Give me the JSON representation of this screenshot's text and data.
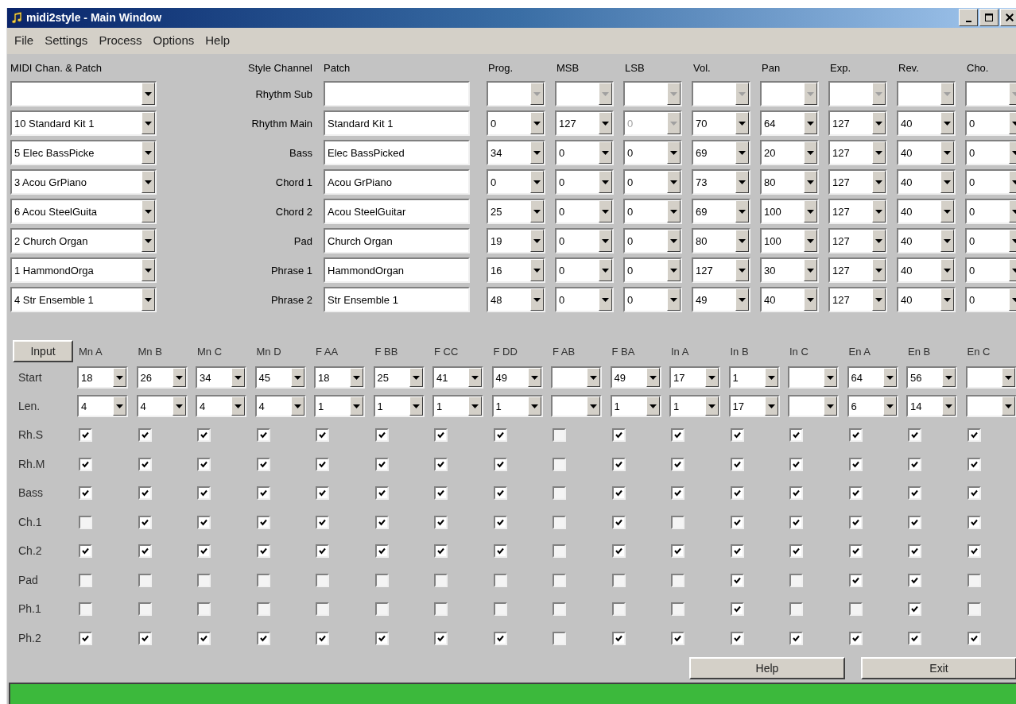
{
  "window": {
    "title": "midi2style - Main Window"
  },
  "menu": [
    "File",
    "Settings",
    "Process",
    "Options",
    "Help"
  ],
  "channel_table": {
    "columns": [
      "MIDI Chan. & Patch",
      "Style Channel",
      "Patch",
      "Prog.",
      "MSB",
      "LSB",
      "Vol.",
      "Pan",
      "Exp.",
      "Rev.",
      "Cho."
    ],
    "rows": [
      {
        "style_channel": "Rhythm Sub",
        "controls": [
          {
            "disabled": true
          },
          {
            "disabled": true
          },
          {
            "disabled": true
          },
          {
            "disabled": true
          },
          {
            "disabled": true
          },
          {
            "disabled": true
          },
          {
            "disabled": true
          },
          {
            "disabled": true
          }
        ]
      },
      {
        "midi": "10 Standard Kit 1",
        "style_channel": "Rhythm Main",
        "patch": "Standard Kit 1",
        "controls": [
          {
            "value": "0",
            "disabled": false
          },
          {
            "value": "127",
            "disabled": false
          },
          {
            "value": "0",
            "disabled": true
          },
          {
            "value": "70",
            "disabled": false
          },
          {
            "value": "64",
            "disabled": false
          },
          {
            "value": "127",
            "disabled": false
          },
          {
            "value": "40",
            "disabled": false
          },
          {
            "value": "0",
            "disabled": false
          }
        ]
      },
      {
        "midi": "5 Elec BassPicke",
        "style_channel": "Bass",
        "patch": "Elec BassPicked",
        "controls": [
          {
            "value": "34",
            "disabled": false
          },
          {
            "value": "0",
            "disabled": false
          },
          {
            "value": "0",
            "disabled": false
          },
          {
            "value": "69",
            "disabled": false
          },
          {
            "value": "20",
            "disabled": false
          },
          {
            "value": "127",
            "disabled": false
          },
          {
            "value": "40",
            "disabled": false
          },
          {
            "value": "0",
            "disabled": false
          }
        ]
      },
      {
        "midi": "3 Acou GrPiano",
        "style_channel": "Chord 1",
        "patch": "Acou GrPiano",
        "controls": [
          {
            "value": "0",
            "disabled": false
          },
          {
            "value": "0",
            "disabled": false
          },
          {
            "value": "0",
            "disabled": false
          },
          {
            "value": "73",
            "disabled": false
          },
          {
            "value": "80",
            "disabled": false
          },
          {
            "value": "127",
            "disabled": false
          },
          {
            "value": "40",
            "disabled": false
          },
          {
            "value": "0",
            "disabled": false
          }
        ]
      },
      {
        "midi": "6 Acou SteelGuita",
        "style_channel": "Chord 2",
        "patch": "Acou SteelGuitar",
        "controls": [
          {
            "value": "25",
            "disabled": false
          },
          {
            "value": "0",
            "disabled": false
          },
          {
            "value": "0",
            "disabled": false
          },
          {
            "value": "69",
            "disabled": false
          },
          {
            "value": "100",
            "disabled": false
          },
          {
            "value": "127",
            "disabled": false
          },
          {
            "value": "40",
            "disabled": false
          },
          {
            "value": "0",
            "disabled": false
          }
        ]
      },
      {
        "midi": "2 Church Organ",
        "style_channel": "Pad",
        "patch": "Church Organ",
        "controls": [
          {
            "value": "19",
            "disabled": false
          },
          {
            "value": "0",
            "disabled": false
          },
          {
            "value": "0",
            "disabled": false
          },
          {
            "value": "80",
            "disabled": false
          },
          {
            "value": "100",
            "disabled": false
          },
          {
            "value": "127",
            "disabled": false
          },
          {
            "value": "40",
            "disabled": false
          },
          {
            "value": "0",
            "disabled": false
          }
        ]
      },
      {
        "midi": "1 HammondOrga",
        "style_channel": "Phrase 1",
        "patch": "HammondOrgan",
        "controls": [
          {
            "value": "16",
            "disabled": false
          },
          {
            "value": "0",
            "disabled": false
          },
          {
            "value": "0",
            "disabled": false
          },
          {
            "value": "127",
            "disabled": false
          },
          {
            "value": "30",
            "disabled": false
          },
          {
            "value": "127",
            "disabled": false
          },
          {
            "value": "40",
            "disabled": false
          },
          {
            "value": "0",
            "disabled": false
          }
        ]
      },
      {
        "midi": "4 Str Ensemble 1",
        "style_channel": "Phrase 2",
        "patch": "Str Ensemble 1",
        "controls": [
          {
            "value": "48",
            "disabled": false
          },
          {
            "value": "0",
            "disabled": false
          },
          {
            "value": "0",
            "disabled": false
          },
          {
            "value": "49",
            "disabled": false
          },
          {
            "value": "40",
            "disabled": false
          },
          {
            "value": "127",
            "disabled": false
          },
          {
            "value": "40",
            "disabled": false
          },
          {
            "value": "0",
            "disabled": false
          }
        ]
      }
    ]
  },
  "sections": {
    "input_button": "Input",
    "start_label": "Start",
    "len_label": "Len.",
    "columns": [
      {
        "label": "Mn A",
        "start": "18",
        "len": "4"
      },
      {
        "label": "Mn B",
        "start": "26",
        "len": "4"
      },
      {
        "label": "Mn C",
        "start": "34",
        "len": "4"
      },
      {
        "label": "Mn D",
        "start": "45",
        "len": "4"
      },
      {
        "label": "F AA",
        "start": "18",
        "len": "1"
      },
      {
        "label": "F BB",
        "start": "25",
        "len": "1"
      },
      {
        "label": "F CC",
        "start": "41",
        "len": "1"
      },
      {
        "label": "F DD",
        "start": "49",
        "len": "1"
      },
      {
        "label": "F AB"
      },
      {
        "label": "F BA",
        "start": "49",
        "len": "1"
      },
      {
        "label": "In A",
        "start": "17",
        "len": "1"
      },
      {
        "label": "In B",
        "start": "1",
        "len": "17"
      },
      {
        "label": "In C"
      },
      {
        "label": "En A",
        "start": "64",
        "len": "6"
      },
      {
        "label": "En B",
        "start": "56",
        "len": "14"
      },
      {
        "label": "En C"
      }
    ],
    "rows": [
      {
        "label": "Rh.S",
        "checks": [
          true,
          true,
          true,
          true,
          true,
          true,
          true,
          true,
          false,
          true,
          true,
          true,
          true,
          true,
          true,
          true
        ]
      },
      {
        "label": "Rh.M",
        "checks": [
          true,
          true,
          true,
          true,
          true,
          true,
          true,
          true,
          false,
          true,
          true,
          true,
          true,
          true,
          true,
          true
        ]
      },
      {
        "label": "Bass",
        "checks": [
          true,
          true,
          true,
          true,
          true,
          true,
          true,
          true,
          false,
          true,
          true,
          true,
          true,
          true,
          true,
          true
        ]
      },
      {
        "label": "Ch.1",
        "checks": [
          false,
          true,
          true,
          true,
          true,
          true,
          true,
          true,
          false,
          true,
          false,
          true,
          true,
          true,
          true,
          true
        ]
      },
      {
        "label": "Ch.2",
        "checks": [
          true,
          true,
          true,
          true,
          true,
          true,
          true,
          true,
          false,
          true,
          true,
          true,
          true,
          true,
          true,
          true
        ]
      },
      {
        "label": "Pad",
        "checks": [
          false,
          false,
          false,
          false,
          false,
          false,
          false,
          false,
          false,
          false,
          false,
          true,
          false,
          true,
          true,
          false
        ]
      },
      {
        "label": "Ph.1",
        "checks": [
          false,
          false,
          false,
          false,
          false,
          false,
          false,
          false,
          false,
          false,
          false,
          true,
          false,
          false,
          true,
          false
        ]
      },
      {
        "label": "Ph.2",
        "checks": [
          true,
          true,
          true,
          true,
          true,
          true,
          true,
          true,
          false,
          true,
          true,
          true,
          true,
          true,
          true,
          true
        ]
      }
    ]
  },
  "buttons": [
    "Help",
    "Exit"
  ]
}
